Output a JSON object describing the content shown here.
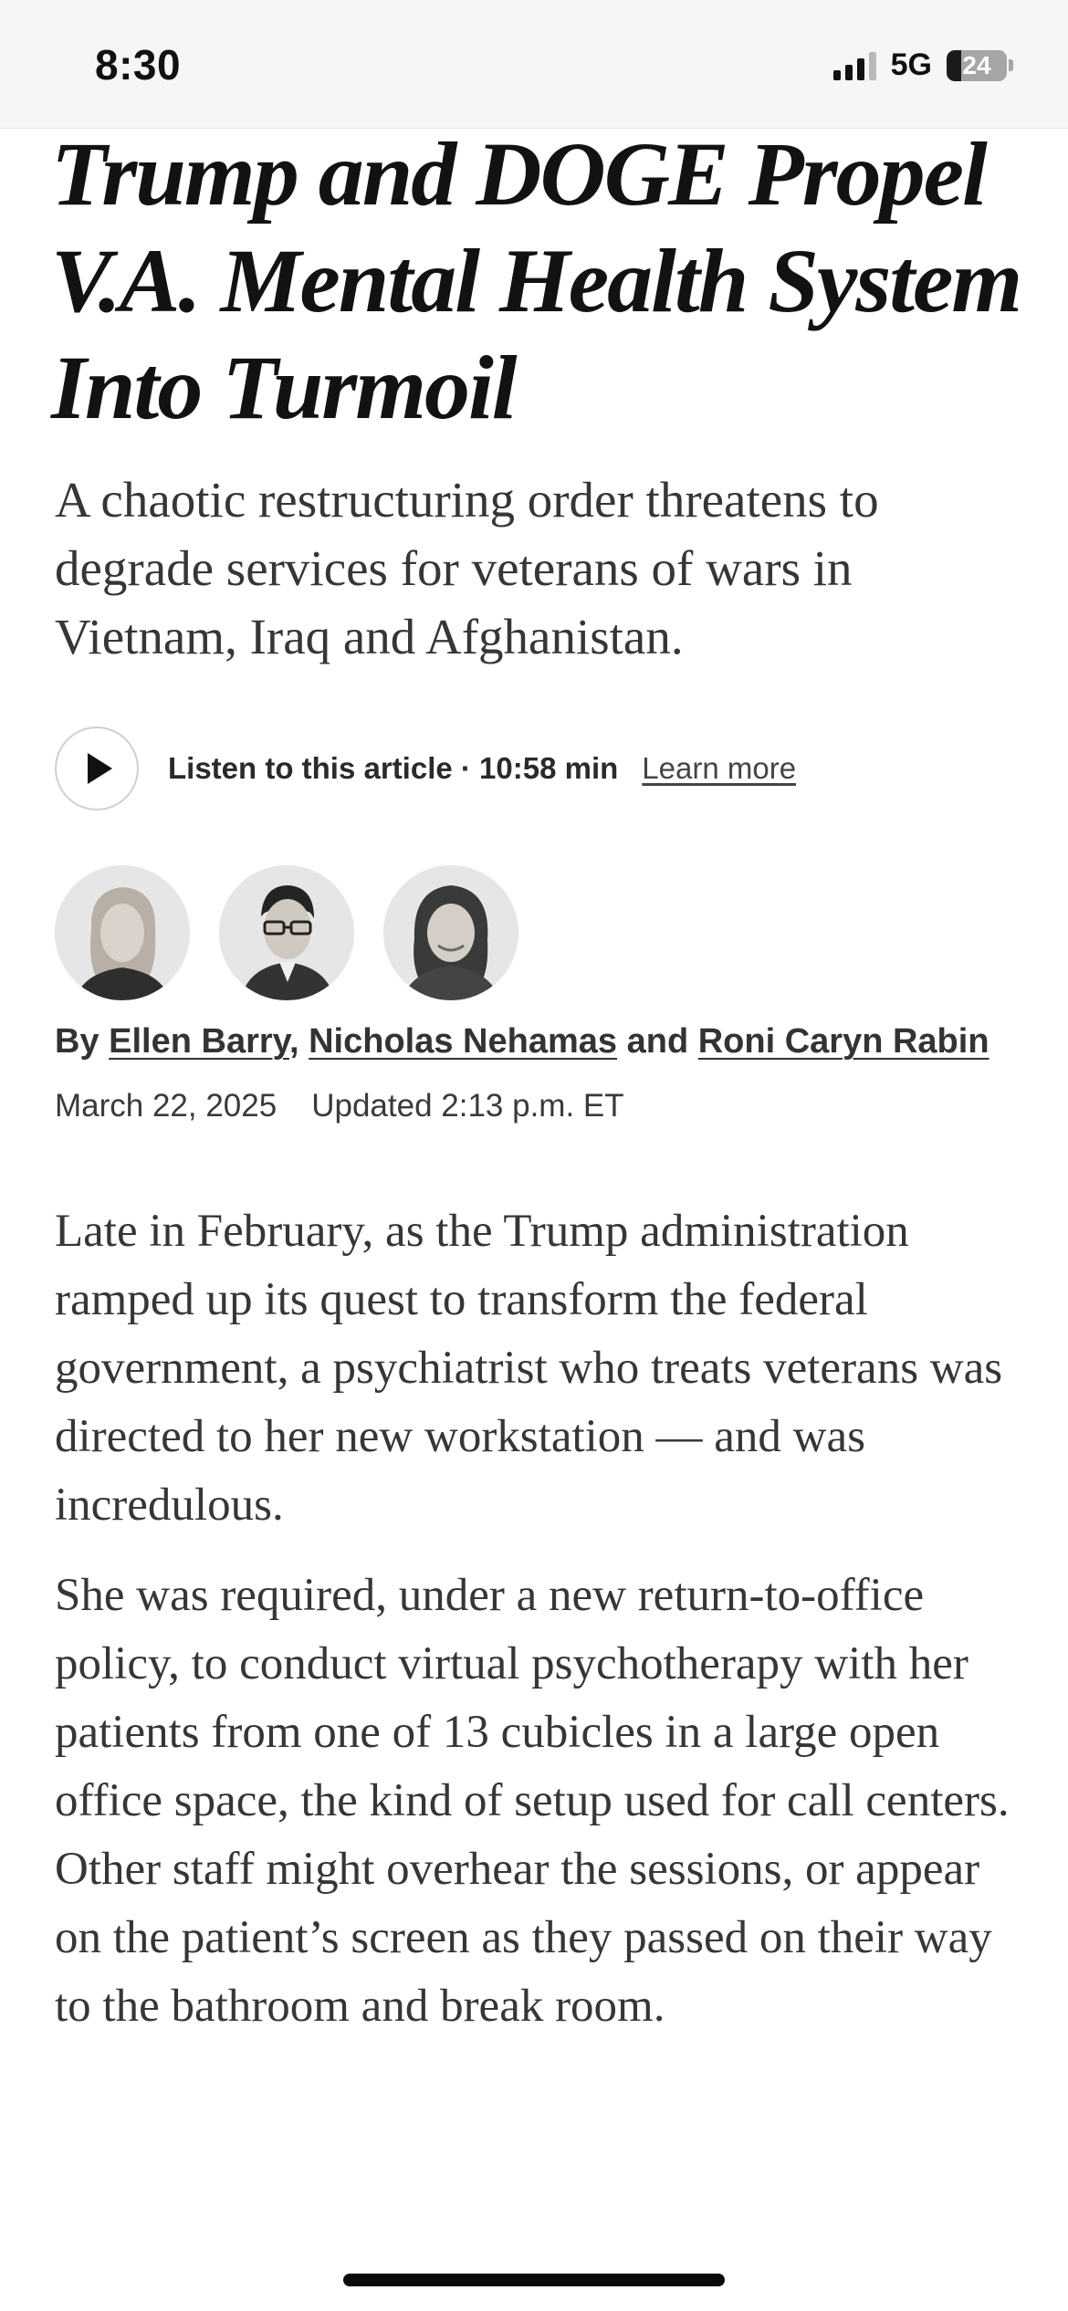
{
  "status_bar": {
    "time": "8:30",
    "network": "5G",
    "battery": "24",
    "battery_level": 0.24
  },
  "article": {
    "headline": "Trump and DOGE Propel V.A. Mental Health System Into Turmoil",
    "summary": "A chaotic restructuring order threatens to degrade services for veterans of wars in Vietnam, Iraq and Afghanistan.",
    "listen": {
      "label": "Listen to this article · 10:58 min",
      "learn_more": "Learn more",
      "icon": "play-icon"
    },
    "byline": {
      "prefix": "By",
      "authors": [
        "Ellen Barry",
        "Nicholas Nehamas",
        "Roni Caryn Rabin"
      ],
      "separator": ",",
      "conjunction": "and"
    },
    "date": "March 22, 2025",
    "updated": "Updated 2:13 p.m. ET",
    "paragraphs": [
      "Late in February, as the Trump administration ramped up its quest to transform the federal government, a psychiatrist who treats veterans was directed to her new workstation — and was incredulous.",
      "She was required, under a new return-to-office policy, to conduct virtual psychotherapy with her patients from one of 13 cubicles in a large open office space, the kind of setup used for call centers. Other staff might overhear the sessions, or appear on the patient’s screen as they passed on their way to the bathroom and break room."
    ]
  }
}
